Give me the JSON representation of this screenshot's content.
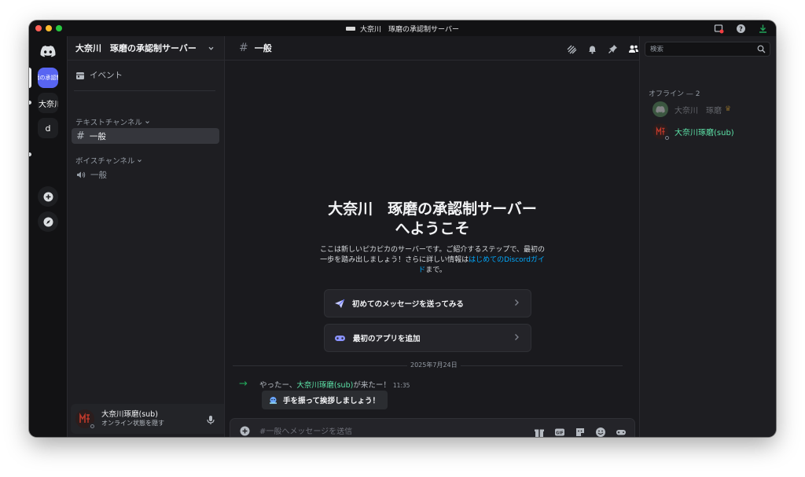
{
  "window": {
    "title": "大奈川　琢磨の承認制サーバー"
  },
  "rail": {
    "server1_label": "磨の承認制",
    "server2_label": "大奈川",
    "server3_label": "d"
  },
  "sidebar": {
    "server_name": "大奈川　琢磨の承認制サーバー",
    "events_label": "イベント",
    "text_category": "テキストチャンネル",
    "voice_category": "ボイスチャンネル",
    "text_channel": "一般",
    "voice_channel": "一般"
  },
  "user_panel": {
    "name": "大奈川琢磨(sub)",
    "status_text": "オンライン状態を隠す"
  },
  "main": {
    "channel_name": "一般",
    "welcome_title": "大奈川　琢磨の承認制サーバーへようこそ",
    "welcome_desc_1": "ここは新しいピカピカのサーバーです。ご紹介するステップで、最初の一歩を踏み出しましょう！さらに詳しい情報は",
    "welcome_link": "はじめてのDiscordガイド",
    "welcome_desc_2": "まで。",
    "card1_label": "初めてのメッセージを送ってみる",
    "card2_label": "最初のアプリを追加",
    "date_divider": "2025年7月24日",
    "join_prefix": "やったー、",
    "join_name": "大奈川琢磨(sub)",
    "join_suffix": "が来たー！",
    "join_time": "11:35",
    "wave_label": "手を振って挨拶しましょう！",
    "composer_placeholder": "#一般へメッセージを送信"
  },
  "members": {
    "search_placeholder": "検索",
    "category": "オフライン — 2",
    "list": [
      {
        "name": "大奈川　琢磨"
      },
      {
        "name": "大奈川琢磨(sub)"
      }
    ]
  },
  "colors": {
    "accent": "#5865f2",
    "join_green": "#23a55a",
    "name_teal": "#5de3a8",
    "link_blue": "#00a8fc"
  }
}
